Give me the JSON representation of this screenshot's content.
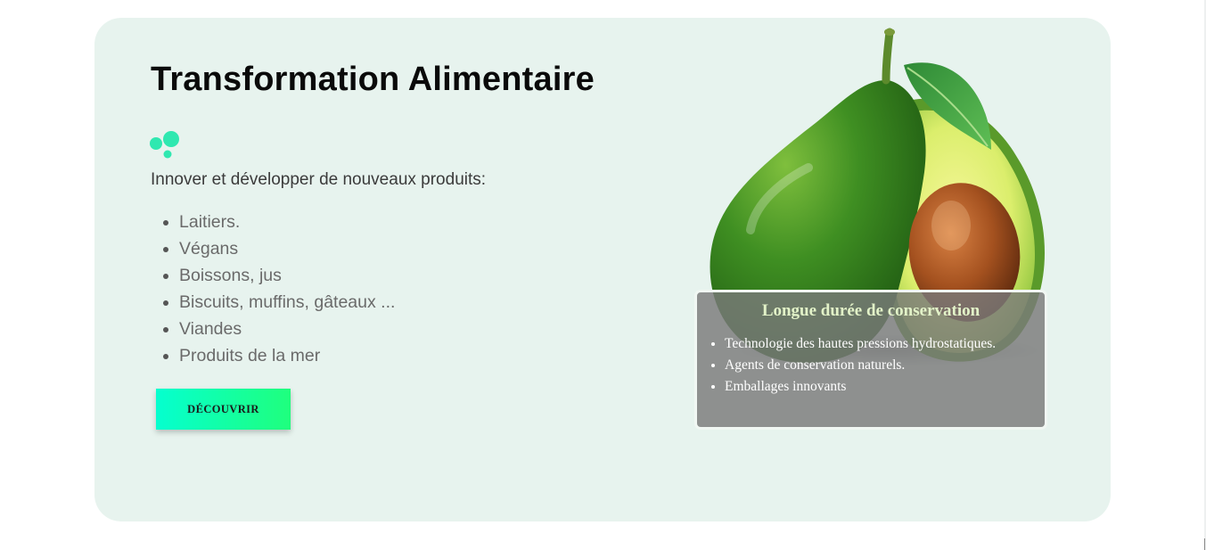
{
  "section": {
    "title": "Transformation Alimentaire",
    "intro": "Innover et développer de nouveaux produits:",
    "products": [
      "Laitiers.",
      "Végans",
      "Boissons, jus",
      "Biscuits, muffins, gâteaux ...",
      "Viandes",
      "Produits de la mer"
    ],
    "cta_label": "DÉCOUVRIR"
  },
  "info_box": {
    "title": "Longue durée de conservation",
    "items": [
      "Technologie des hautes pressions hydrostatiques.",
      "Agents de conservation naturels.",
      "Emballages innovants"
    ]
  },
  "icons": {
    "dots": "decorative-dots-icon",
    "image": "avocado-image"
  },
  "colors": {
    "card_background": "#e7f3ee",
    "accent_start": "#05ffcf",
    "accent_end": "#1fff7d",
    "dot_color": "#2fe8b0",
    "info_title": "#e2f2c8"
  }
}
